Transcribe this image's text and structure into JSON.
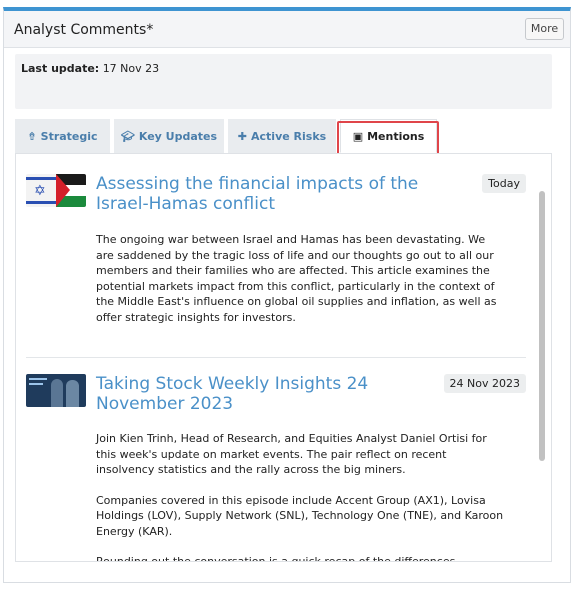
{
  "panel": {
    "title": "Analyst Comments*",
    "more_label": "More"
  },
  "update": {
    "label": "Last update:",
    "value": "17 Nov 23"
  },
  "tabs": [
    {
      "label": "Strategic",
      "icon": "arrow-up-icon"
    },
    {
      "label": "Key Updates",
      "icon": "graduation-cap-icon"
    },
    {
      "label": "Active Risks",
      "icon": "puzzle-icon"
    },
    {
      "label": "Mentions",
      "icon": "comment-icon",
      "active": true
    }
  ],
  "mentions": [
    {
      "title": "Assessing the financial impacts of the Israel-Hamas conflict",
      "date": "Today",
      "thumbnail": "israel-palestine-flags-image",
      "paragraphs": [
        "The ongoing war between Israel and Hamas has been devastating. We are saddened by the tragic loss of life and our thoughts go out to all our members and their families who are affected. This article examines the potential markets impact from this conflict, particularly in the context of the Middle East's influence on global oil supplies and inflation, as well as offer strategic insights for investors."
      ]
    },
    {
      "title": "Taking Stock Weekly Insights 24 November 2023",
      "date": "24 Nov 2023",
      "thumbnail": "podcast-hosts-image",
      "paragraphs": [
        "Join Kien Trinh, Head of Research, and Equities Analyst Daniel Ortisi for this week's update on market events. The pair reflect on recent insolvency statistics and the rally across the big miners.",
        "Companies covered in this episode include Accent Group (AX1), Lovisa Holdings (LOV), Supply Network (SNL), Technology One (TNE), and Karoon Energy (KAR).",
        "Rounding out the conversation is a quick recap of the differences between"
      ]
    }
  ],
  "colors": {
    "accent": "#3e94d1",
    "link": "#4a90c8",
    "highlight": "#e0454a"
  }
}
